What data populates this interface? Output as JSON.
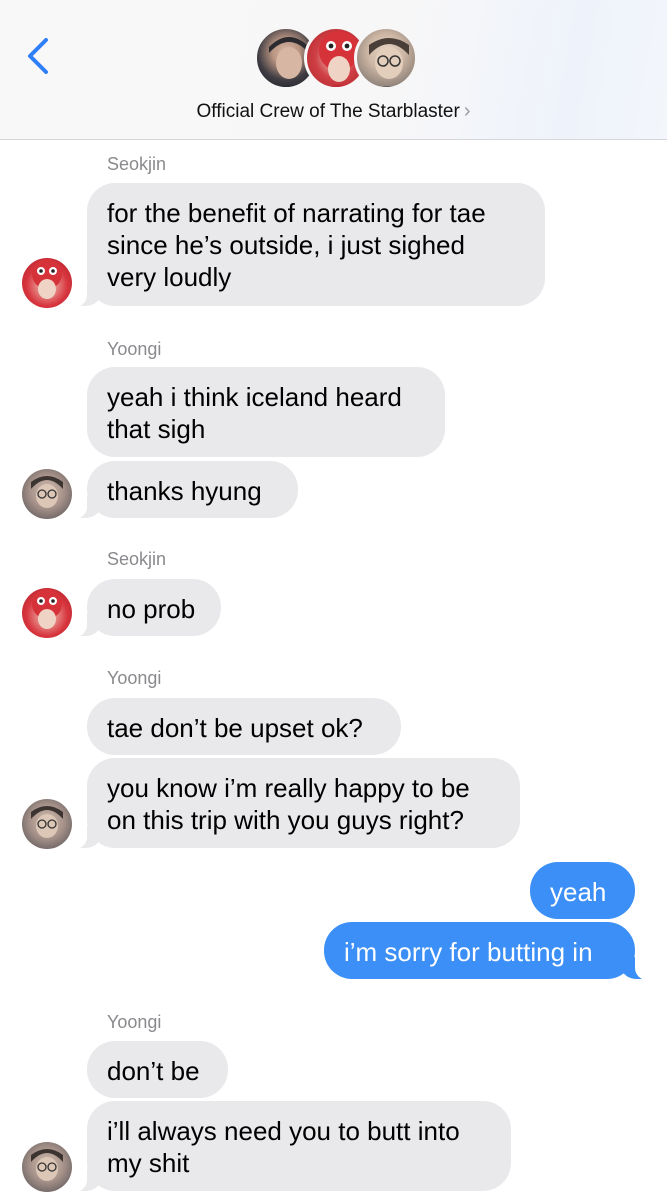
{
  "header": {
    "back_icon": "chevron-left-icon",
    "group_name": "Official Crew of The Starblaster",
    "chevron": "›"
  },
  "colors": {
    "ios_blue": "#3b8ff6",
    "incoming_bubble": "#e9e9eb",
    "sender_gray": "#8a8a8e"
  },
  "messages": [
    {
      "sender": "Seokjin",
      "text": "for the benefit of narrating for tae\nsince he’s outside, i just sighed\nvery loudly"
    },
    {
      "sender": "Yoongi",
      "text": "yeah i think iceland heard\nthat sigh"
    },
    {
      "sender": "",
      "text": "thanks hyung"
    },
    {
      "sender": "Seokjin",
      "text": "no prob"
    },
    {
      "sender": "Yoongi",
      "text": "tae don’t be upset ok?"
    },
    {
      "sender": "",
      "text": "you know i’m really happy to be\non this trip with you guys right?"
    },
    {
      "sender": "me",
      "text": "yeah"
    },
    {
      "sender": "me",
      "text": "i’m sorry for butting in"
    },
    {
      "sender": "Yoongi",
      "text": "don’t be"
    },
    {
      "sender": "",
      "text": "i’ll always need you to butt into\nmy shit"
    }
  ]
}
